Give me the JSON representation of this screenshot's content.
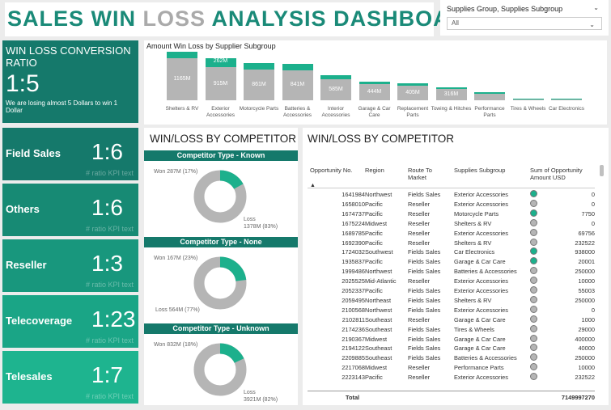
{
  "title": {
    "part1": "SALES WIN ",
    "part2": "LOSS",
    "part3": " ANALYSIS DASHBOARD"
  },
  "slicer": {
    "label": "Supplies Group, Supplies Subgroup",
    "value": "All"
  },
  "ratio_card": {
    "heading": "WIN LOSS CONVERSION RATIO",
    "value": "1:5",
    "subtitle": "We are losing almost 5 Dollars to win 1 Dollar"
  },
  "kpis": [
    {
      "label": "Field Sales",
      "value": "1:6",
      "caption": "# ratio KPI text",
      "color": "#15796b"
    },
    {
      "label": "Others",
      "value": "1:6",
      "caption": "# ratio KPI text",
      "color": "#178a74"
    },
    {
      "label": "Reseller",
      "value": "1:3",
      "caption": "# ratio KPI text",
      "color": "#18977d"
    },
    {
      "label": "Telecoverage",
      "value": "1:23",
      "caption": "# ratio KPI text",
      "color": "#1aa586"
    },
    {
      "label": "Telesales",
      "value": "1:7",
      "caption": "# ratio KPI text",
      "color": "#1eb48f"
    }
  ],
  "bar_chart": {
    "title": "Amount Win Loss by Supplier Subgroup",
    "colors": {
      "win": "#1cb08c",
      "loss": "#b5b5b5"
    },
    "categories": [
      {
        "name": "Shelters & RV",
        "loss": 1165,
        "win": 190,
        "loss_label": "1165M",
        "win_label": ""
      },
      {
        "name": "Exterior Accessories",
        "loss": 915,
        "win": 262,
        "loss_label": "915M",
        "win_label": "262M"
      },
      {
        "name": "Motorcycle Parts",
        "loss": 861,
        "win": 170,
        "loss_label": "861M",
        "win_label": ""
      },
      {
        "name": "Batteries & Accessories",
        "loss": 841,
        "win": 165,
        "loss_label": "841M",
        "win_label": ""
      },
      {
        "name": "Interior Accessories",
        "loss": 585,
        "win": 110,
        "loss_label": "585M",
        "win_label": ""
      },
      {
        "name": "Garage & Car Care",
        "loss": 444,
        "win": 70,
        "loss_label": "444M",
        "win_label": ""
      },
      {
        "name": "Replacement Parts",
        "loss": 405,
        "win": 75,
        "loss_label": "405M",
        "win_label": ""
      },
      {
        "name": "Towing & Hitches",
        "loss": 316,
        "win": 55,
        "loss_label": "316M",
        "win_label": ""
      },
      {
        "name": "Performance Parts",
        "loss": 180,
        "win": 40,
        "loss_label": "",
        "win_label": ""
      },
      {
        "name": "Tires & Wheels",
        "loss": 40,
        "win": 8,
        "loss_label": "",
        "win_label": ""
      },
      {
        "name": "Car Electronics",
        "loss": 20,
        "win": 5,
        "loss_label": "",
        "win_label": ""
      }
    ]
  },
  "donuts": {
    "title": "WIN/LOSS BY COMPETITOR",
    "items": [
      {
        "heading": "Competitor Type - Known",
        "win_label": "Won 287M (17%)",
        "loss_label_1": "Loss",
        "loss_label_2": "1378M (83%)",
        "win_fraction": 0.17
      },
      {
        "heading": "Competitor Type - None",
        "win_label": "Won 167M (23%)",
        "loss_label_1": "Loss 564M (77%)",
        "loss_label_2": "",
        "win_fraction": 0.23
      },
      {
        "heading": "Competitor Type - Unknown",
        "win_label": "Won 832M (18%)",
        "loss_label_1": "Loss",
        "loss_label_2": "3921M (82%)",
        "win_fraction": 0.18
      }
    ]
  },
  "table": {
    "title": "WIN/LOSS BY COMPETITOR",
    "headers": {
      "opp": "Opportunity No.",
      "region": "Region",
      "route_1": "Route To",
      "route_2": "Market",
      "sub": "Supplies Subgroup",
      "sum_1": "Sum of Opportunity",
      "sum_2": "Amount USD"
    },
    "colors": {
      "won": "#1cb08c",
      "lost": "#b5b5b5"
    },
    "rows": [
      {
        "opp": "1641984",
        "region": "Northwest",
        "route": "Fields Sales",
        "sub": "Exterior Accessories",
        "won": true,
        "amt": "0"
      },
      {
        "opp": "1658010",
        "region": "Pacific",
        "route": "Reseller",
        "sub": "Exterior Accessories",
        "won": false,
        "amt": "0"
      },
      {
        "opp": "1674737",
        "region": "Pacific",
        "route": "Reseller",
        "sub": "Motorcycle Parts",
        "won": true,
        "amt": "7750"
      },
      {
        "opp": "1675224",
        "region": "Midwest",
        "route": "Reseller",
        "sub": "Shelters & RV",
        "won": false,
        "amt": "0"
      },
      {
        "opp": "1689785",
        "region": "Pacific",
        "route": "Reseller",
        "sub": "Exterior Accessories",
        "won": false,
        "amt": "69756"
      },
      {
        "opp": "1692390",
        "region": "Pacific",
        "route": "Reseller",
        "sub": "Shelters & RV",
        "won": false,
        "amt": "232522"
      },
      {
        "opp": "1724032",
        "region": "Southwest",
        "route": "Fields Sales",
        "sub": "Car Electronics",
        "won": true,
        "amt": "938000"
      },
      {
        "opp": "1935837",
        "region": "Pacific",
        "route": "Fields Sales",
        "sub": "Garage & Car Care",
        "won": true,
        "amt": "20001"
      },
      {
        "opp": "1999486",
        "region": "Northwest",
        "route": "Fields Sales",
        "sub": "Batteries & Accessories",
        "won": false,
        "amt": "250000"
      },
      {
        "opp": "2025525",
        "region": "Mid-Atlantic",
        "route": "Reseller",
        "sub": "Exterior Accessories",
        "won": false,
        "amt": "10000"
      },
      {
        "opp": "2052337",
        "region": "Pacific",
        "route": "Fields Sales",
        "sub": "Exterior Accessories",
        "won": false,
        "amt": "55003"
      },
      {
        "opp": "2059495",
        "region": "Northeast",
        "route": "Fields Sales",
        "sub": "Shelters & RV",
        "won": false,
        "amt": "250000"
      },
      {
        "opp": "2100568",
        "region": "Northwest",
        "route": "Fields Sales",
        "sub": "Exterior Accessories",
        "won": false,
        "amt": "0"
      },
      {
        "opp": "2102811",
        "region": "Southeast",
        "route": "Reseller",
        "sub": "Garage & Car Care",
        "won": false,
        "amt": "1000"
      },
      {
        "opp": "2174236",
        "region": "Southeast",
        "route": "Fields Sales",
        "sub": "Tires & Wheels",
        "won": false,
        "amt": "29000"
      },
      {
        "opp": "2190367",
        "region": "Midwest",
        "route": "Fields Sales",
        "sub": "Garage & Car Care",
        "won": false,
        "amt": "400000"
      },
      {
        "opp": "2194122",
        "region": "Southeast",
        "route": "Fields Sales",
        "sub": "Garage & Car Care",
        "won": false,
        "amt": "40000"
      },
      {
        "opp": "2209885",
        "region": "Southeast",
        "route": "Fields Sales",
        "sub": "Batteries & Accessories",
        "won": false,
        "amt": "250000"
      },
      {
        "opp": "2217068",
        "region": "Midwest",
        "route": "Reseller",
        "sub": "Performance Parts",
        "won": false,
        "amt": "10000"
      },
      {
        "opp": "2223143",
        "region": "Pacific",
        "route": "Reseller",
        "sub": "Exterior Accessories",
        "won": false,
        "amt": "232522"
      }
    ],
    "total_label": "Total",
    "total_value": "7149997270"
  }
}
